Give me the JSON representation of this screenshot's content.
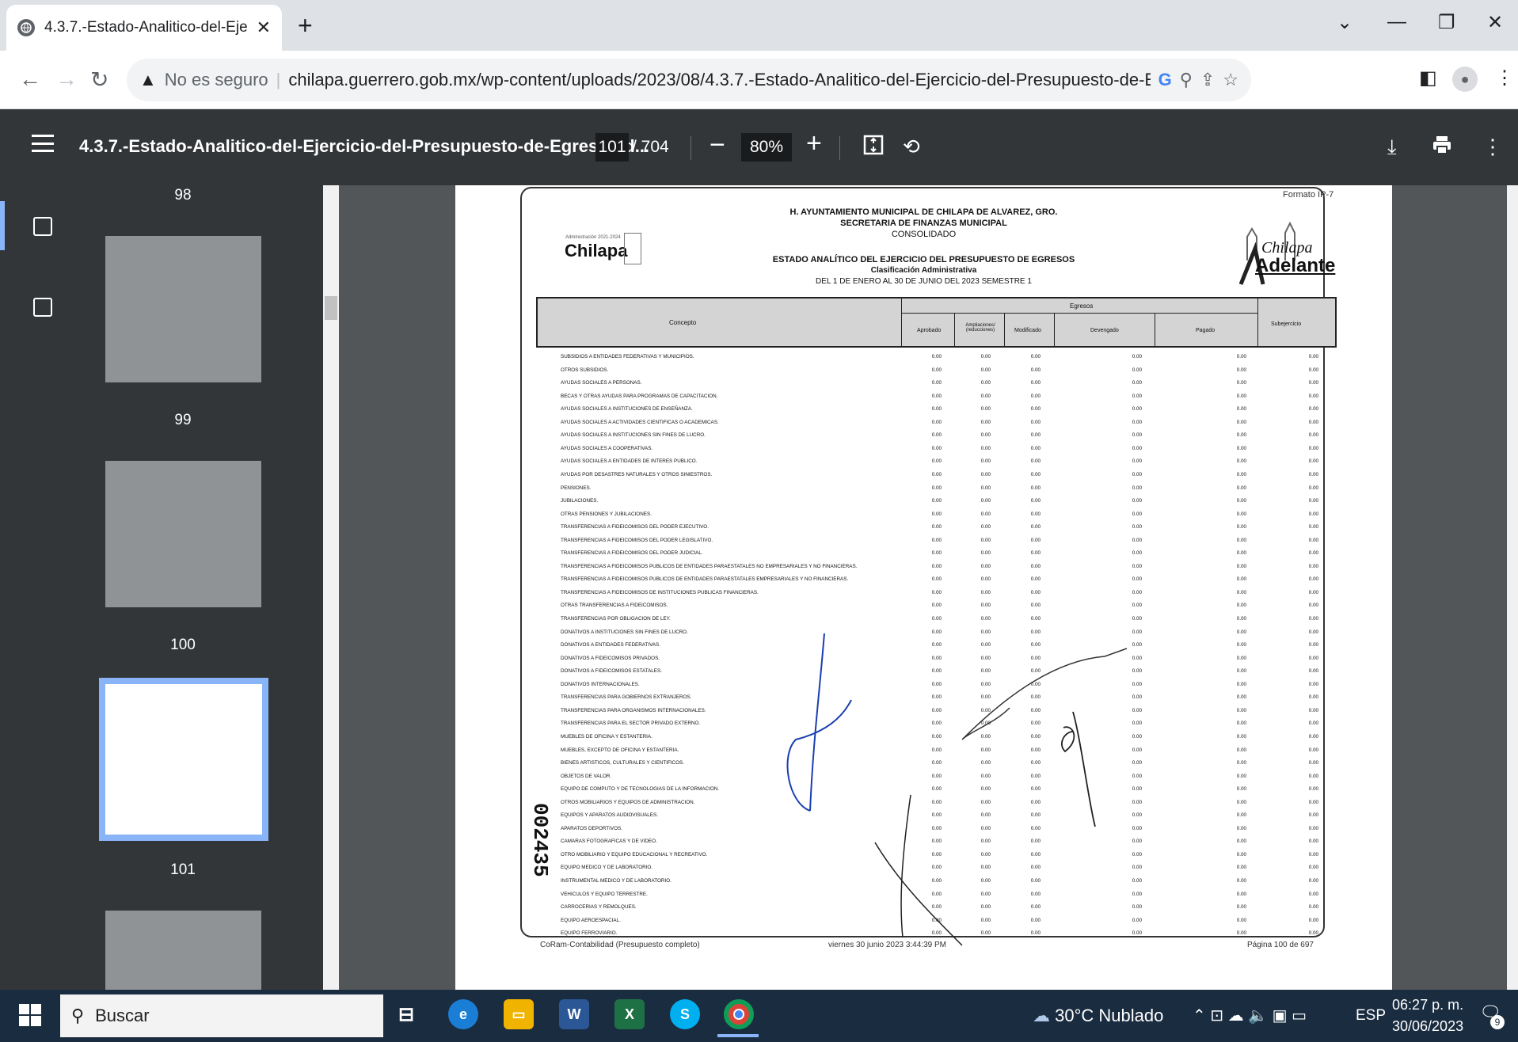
{
  "browser": {
    "tab_title": "4.3.7.-Estado-Analitico-del-Ejerci",
    "not_secure": "No es seguro",
    "url": "chilapa.guerrero.gob.mx/wp-content/uploads/2023/08/4.3.7.-Estado-Analitico-del-Ejercicio-del-Presupuesto-de-Egresos-de-Acuerdo-a-su-..."
  },
  "viewer": {
    "title": "4.3.7.-Estado-Analitico-del-Ejercicio-del-Presupuesto-de-Egresos-d...",
    "current_page": "101",
    "total_pages": "/ 704",
    "zoom": "80%",
    "thumbnails": [
      "98",
      "99",
      "100",
      "101"
    ]
  },
  "document": {
    "format": "Formato IP-7",
    "line1": "H. AYUNTAMIENTO MUNICIPAL DE CHILAPA DE ALVAREZ, GRO.",
    "line2": "SECRETARIA DE FINANZAS MUNICIPAL",
    "line3": "CONSOLIDADO",
    "line4": "ESTADO ANALÍTICO DEL EJERCICIO DEL PRESUPUESTO DE EGRESOS",
    "line5": "Clasificación Administrativa",
    "line6": "DEL 1 DE ENERO AL 30 DE JUNIO DEL 2023 SEMESTRE 1",
    "logo_left": "Chilapa",
    "logo_left_sub": "Administración 2021-2024",
    "logo_right_top": "Chilapa",
    "logo_right_bottom": "Adelante",
    "header_concepto": "Concepto",
    "header_egresos": "Egresos",
    "col_aprobado": "Aprobado",
    "col_ampliaciones": "Ampliaciones/ (reducciones)",
    "col_modificado": "Modificado",
    "col_devengado": "Devengado",
    "col_pagado": "Pagado",
    "col_subejercicio": "Subejercicio",
    "folio": "002435",
    "footer_left": "CoRam-Contabilidad (Presupuesto completo)",
    "footer_center": "viernes 30 junio 2023 3:44:39 PM",
    "footer_right": "Página 100 de 697",
    "zero": "0.00",
    "rows": [
      "SUBSIDIOS A ENTIDADES FEDERATIVAS Y MUNICIPIOS.",
      "OTROS SUBSIDIOS.",
      "AYUDAS SOCIALES A PERSONAS.",
      "BECAS Y OTRAS AYUDAS PARA PROGRAMAS DE CAPACITACION.",
      "AYUDAS SOCIALES A INSTITUCIONES DE ENSEÑANZA.",
      "AYUDAS SOCIALES A ACTIVIDADES CIENTIFICAS O ACADEMICAS.",
      "AYUDAS SOCIALES A INSTITUCIONES SIN FINES DE LUCRO.",
      "AYUDAS SOCIALES A COOPERATIVAS.",
      "AYUDAS SOCIALES A ENTIDADES DE INTERES PUBLICO.",
      "AYUDAS POR DESASTRES NATURALES Y OTROS SINIESTROS.",
      "PENSIONES.",
      "JUBILACIONES.",
      "OTRAS PENSIONES Y JUBILACIONES.",
      "TRANSFERENCIAS A FIDEICOMISOS DEL PODER EJECUTIVO.",
      "TRANSFERENCIAS A FIDEICOMISOS DEL PODER LEGISLATIVO.",
      "TRANSFERENCIAS A FIDEICOMISOS DEL PODER JUDICIAL.",
      "TRANSFERENCIAS A FIDEICOMISOS PUBLICOS DE ENTIDADES PARAESTATALES NO EMPRESARIALES Y NO FINANCIERAS.",
      "TRANSFERENCIAS A FIDEICOMISOS PUBLICOS DE ENTIDADES PARAESTATALES EMPRESARIALES Y NO FINANCIERAS.",
      "TRANSFERENCIAS A FIDEICOMISOS DE INSTITUCIONES PUBLICAS FINANCIERAS.",
      "OTRAS TRANSFERENCIAS A FIDEICOMISOS.",
      "TRANSFERENCIAS POR OBLIGACION DE LEY.",
      "DONATIVOS A INSTITUCIONES SIN FINES DE LUCRO.",
      "DONATIVOS A ENTIDADES FEDERATIVAS.",
      "DONATIVOS A FIDEICOMISOS PRIVADOS.",
      "DONATIVOS A FIDEICOMISOS ESTATALES.",
      "DONATIVOS INTERNACIONALES.",
      "TRANSFERENCIAS PARA GOBIERNOS EXTRANJEROS.",
      "TRANSFERENCIAS PARA ORGANISMOS INTERNACIONALES.",
      "TRANSFERENCIAS PARA EL SECTOR PRIVADO EXTERNO.",
      "MUEBLES DE OFICINA Y ESTANTERIA.",
      "MUEBLES, EXCEPTO DE OFICINA Y ESTANTERIA.",
      "BIENES ARTISTICOS, CULTURALES Y CIENTIFICOS.",
      "OBJETOS DE VALOR.",
      "EQUIPO DE COMPUTO Y DE TECNOLOGIAS DE LA INFORMACION.",
      "OTROS MOBILIARIOS Y EQUIPOS DE ADMINISTRACION.",
      "EQUIPOS Y APARATOS AUDIOVISUALES.",
      "APARATOS DEPORTIVOS.",
      "CAMARAS FOTOGRAFICAS Y DE VIDEO.",
      "OTRO MOBILIARIO Y EQUIPO EDUCACIONAL Y RECREATIVO.",
      "EQUIPO MEDICO Y DE LABORATORIO.",
      "INSTRUMENTAL MEDICO Y DE LABORATORIO.",
      "VEHICULOS Y EQUIPO TERRESTRE.",
      "CARROCERIAS Y REMOLQUES.",
      "EQUIPO AEROESPACIAL.",
      "EQUIPO FERROVIARIO."
    ]
  },
  "taskbar": {
    "search": "Buscar",
    "weather": "30°C  Nublado",
    "lang": "ESP",
    "time": "06:27 p. m.",
    "date": "30/06/2023",
    "notif": "9"
  }
}
